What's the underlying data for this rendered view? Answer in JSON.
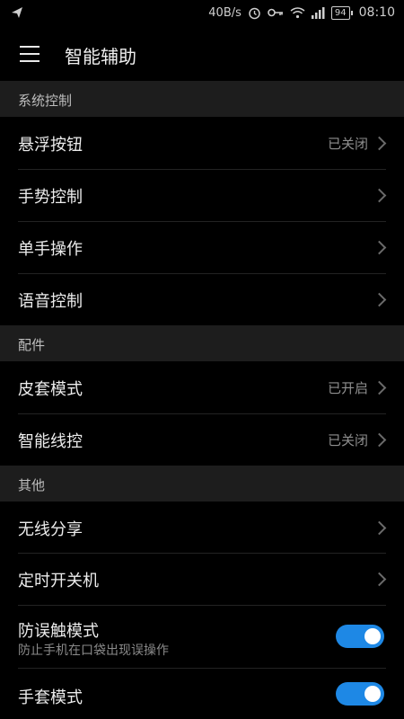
{
  "status_bar": {
    "net_speed": "40B/s",
    "battery": "94",
    "time": "08:10",
    "icons": [
      "send-icon",
      "alarm-icon",
      "key-icon",
      "wifi-icon",
      "signal-icon",
      "battery-icon"
    ]
  },
  "app_bar": {
    "title": "智能辅助",
    "menu_icon": "hamburger-menu-icon"
  },
  "sections": [
    {
      "header": "系统控制",
      "items": [
        {
          "label": "悬浮按钮",
          "value": "已关闭"
        },
        {
          "label": "手势控制"
        },
        {
          "label": "单手操作"
        },
        {
          "label": "语音控制"
        }
      ]
    },
    {
      "header": "配件",
      "items": [
        {
          "label": "皮套模式",
          "value": "已开启"
        },
        {
          "label": "智能线控",
          "value": "已关闭"
        }
      ]
    },
    {
      "header": "其他",
      "items": [
        {
          "label": "无线分享"
        },
        {
          "label": "定时开关机"
        },
        {
          "label": "防误触模式",
          "subtitle": "防止手机在口袋出现误操作",
          "toggle": true
        },
        {
          "label": "手套模式",
          "toggle": true
        }
      ]
    }
  ],
  "colors": {
    "background": "#000000",
    "section_header_bg": "#1d1d1d",
    "accent": "#1e88e5"
  }
}
